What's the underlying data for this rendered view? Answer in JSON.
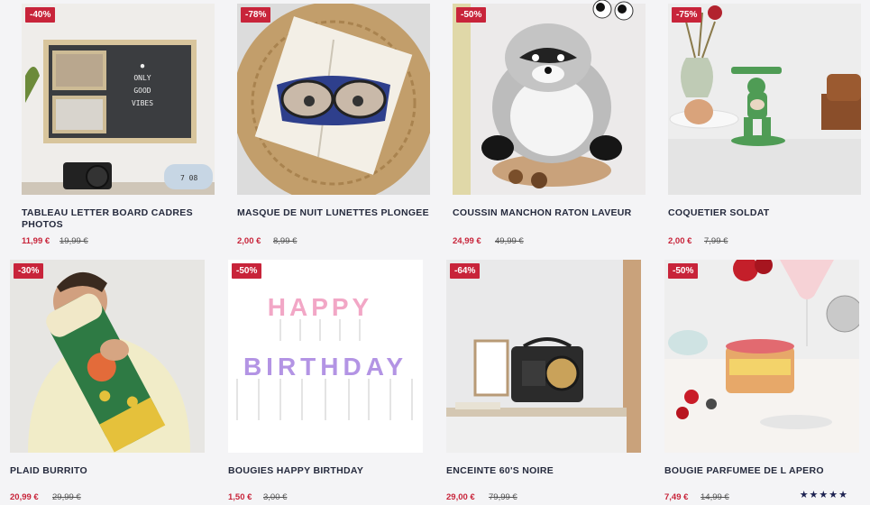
{
  "products": [
    {
      "badge": "-40%",
      "title": "TABLEAU LETTER BOARD CADRES PHOTOS",
      "price": "11,99 €",
      "old_price": "19,99 €",
      "board_text": [
        "ONLY",
        "GOOD",
        "VIBES"
      ],
      "clock": "7 08"
    },
    {
      "badge": "-78%",
      "title": "MASQUE DE NUIT LUNETTES PLONGEE",
      "price": "2,00 €",
      "old_price": "8,99 €"
    },
    {
      "badge": "-50%",
      "title": "COUSSIN MANCHON RATON LAVEUR",
      "price": "24,99 €",
      "old_price": "49,99 €"
    },
    {
      "badge": "-75%",
      "title": "COQUETIER SOLDAT",
      "price": "2,00 €",
      "old_price": "7,99 €"
    },
    {
      "badge": "-30%",
      "title": "PLAID BURRITO",
      "price": "20,99 €",
      "old_price": "29,99 €"
    },
    {
      "badge": "-50%",
      "title": "BOUGIES HAPPY BIRTHDAY",
      "price": "1,50 €",
      "old_price": "3,00 €",
      "candles_line1": "HAPPY",
      "candles_line2": "BIRTHDAY"
    },
    {
      "badge": "-64%",
      "title": "ENCEINTE 60'S NOIRE",
      "price": "29,00 €",
      "old_price": "79,99 €"
    },
    {
      "badge": "-50%",
      "title": "BOUGIE PARFUMEE DE L APERO",
      "price": "7,49 €",
      "old_price": "14,99 €",
      "rating": "★★★★★"
    }
  ],
  "colors": {
    "badge": "#c8243a",
    "title": "#252a3d",
    "price": "#c8243a",
    "stars": "#1c2150"
  }
}
